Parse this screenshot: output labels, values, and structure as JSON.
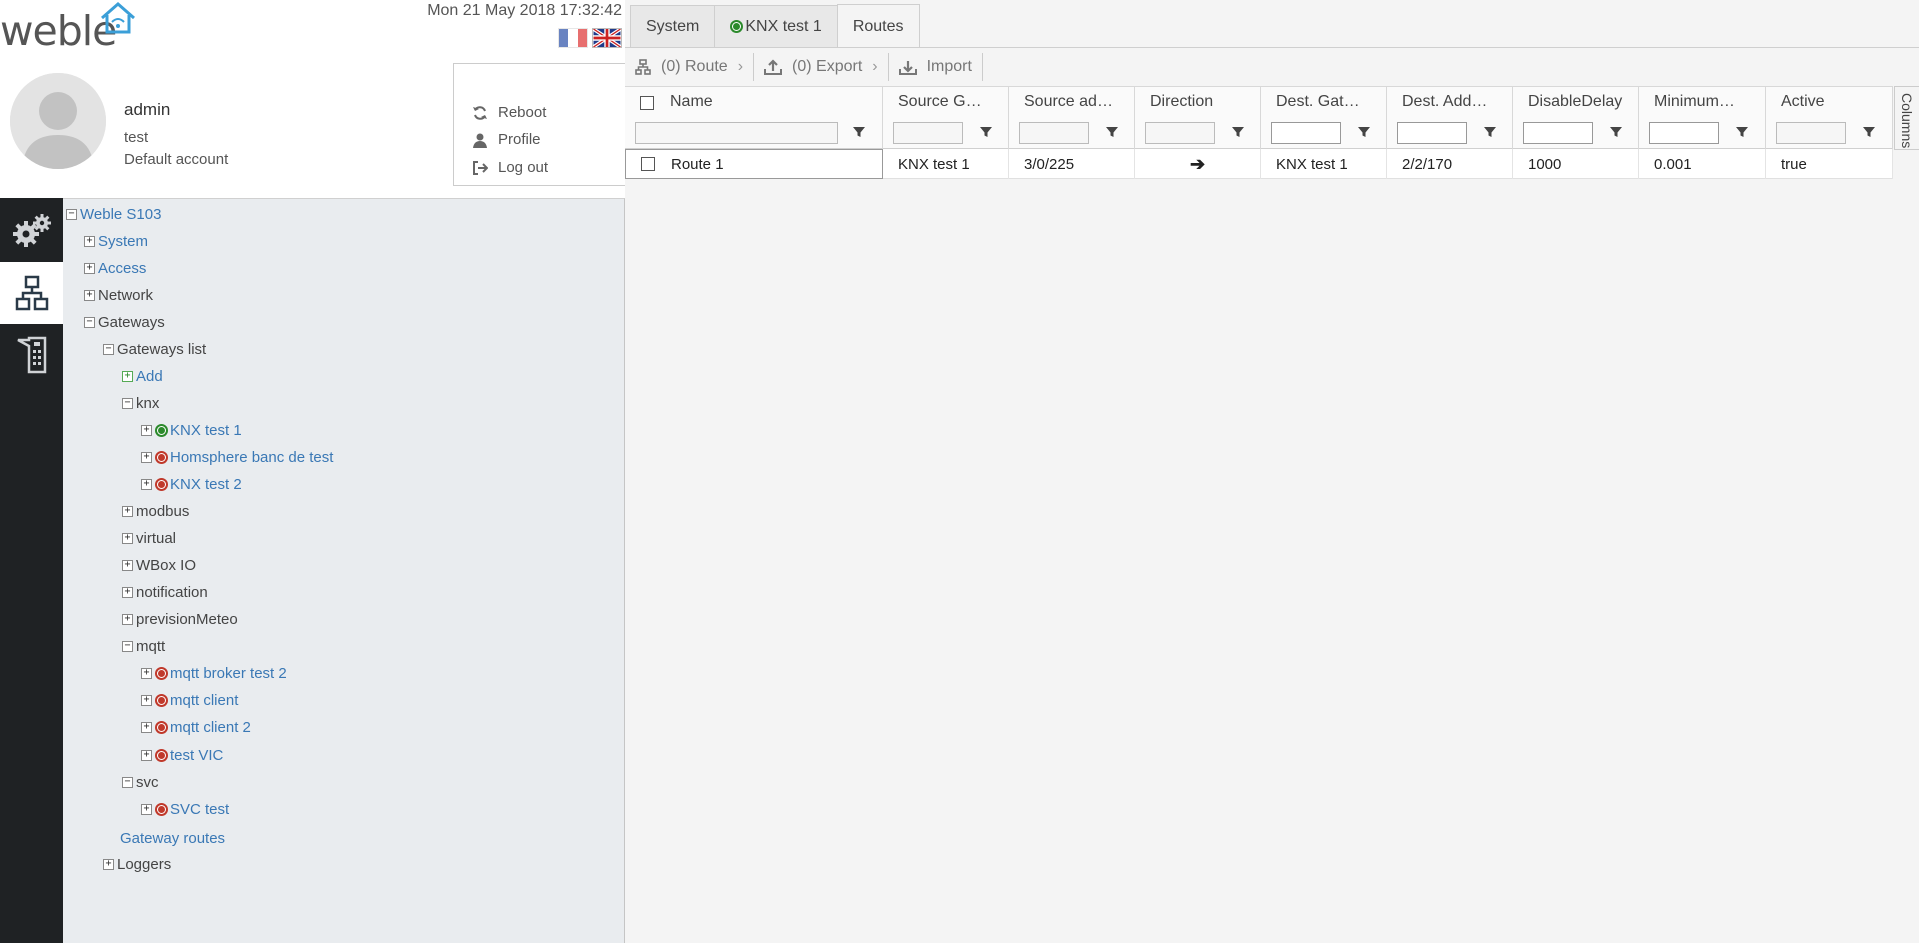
{
  "app": {
    "logo_text": "weble",
    "datetime": "Mon 21 May 2018 17:32:42"
  },
  "user": {
    "name": "admin",
    "username": "test",
    "description": "Default account"
  },
  "user_menu": {
    "reboot": "Reboot",
    "profile": "Profile",
    "logout": "Log out"
  },
  "sidebar": {
    "items": [
      {
        "icon": "gears-icon",
        "active": false
      },
      {
        "icon": "network-icon",
        "active": true
      },
      {
        "icon": "device-icon",
        "active": false
      }
    ]
  },
  "tree": {
    "root": "Weble S103",
    "system": "System",
    "access": "Access",
    "network": "Network",
    "gateways": "Gateways",
    "gateways_list": "Gateways list",
    "add": "Add",
    "knx": "knx",
    "knx_test_1": "KNX test 1",
    "homsphere": "Homsphere banc de test",
    "knx_test_2": "KNX test 2",
    "modbus": "modbus",
    "virtual": "virtual",
    "wbox": "WBox IO",
    "notification": "notification",
    "prevision": "previsionMeteo",
    "mqtt": "mqtt",
    "mqtt_broker": "mqtt broker test 2",
    "mqtt_client": "mqtt client",
    "mqtt_client_2": "mqtt client 2",
    "test_vic": "test VIC",
    "svc": "svc",
    "svc_test": "SVC test",
    "gateway_routes": "Gateway routes",
    "loggers": "Loggers"
  },
  "tabs": {
    "system": "System",
    "knx": "KNX test 1",
    "routes": "Routes"
  },
  "toolbar": {
    "route": "(0) Route",
    "export": "(0) Export",
    "import": "Import"
  },
  "grid": {
    "columns": [
      "Name",
      "Source G…",
      "Source ad…",
      "Direction",
      "Dest. Gat…",
      "Dest. Add…",
      "DisableDelay",
      "Minimum…",
      "Active"
    ],
    "rows": [
      {
        "name": "Route 1",
        "source_gateway": "KNX test 1",
        "source_address": "3/0/225",
        "direction": "➔",
        "dest_gateway": "KNX test 1",
        "dest_address": "2/2/170",
        "disable_delay": "1000",
        "minimum": "0.001",
        "active": "true"
      }
    ],
    "columns_tab": "Columns"
  },
  "colors": {
    "link": "#3a78b5",
    "sidebar": "#1f2224",
    "status_ok": "#2c8a2c",
    "status_error": "#c0392b"
  }
}
